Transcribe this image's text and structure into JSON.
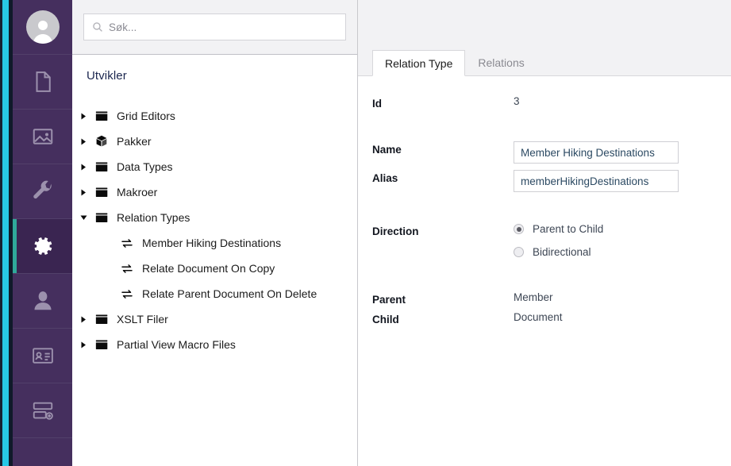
{
  "rail": {
    "avatar": {
      "icon": "user-avatar-icon"
    },
    "items": [
      {
        "icon": "document-icon",
        "name": "content",
        "active": false
      },
      {
        "icon": "media-image-icon",
        "name": "media",
        "active": false
      },
      {
        "icon": "wrench-icon",
        "name": "settings",
        "active": false
      },
      {
        "icon": "gear-icon",
        "name": "developer",
        "active": true
      },
      {
        "icon": "user-icon",
        "name": "users",
        "active": false
      },
      {
        "icon": "id-card-icon",
        "name": "members",
        "active": false
      },
      {
        "icon": "forms-icon",
        "name": "forms",
        "active": false
      }
    ]
  },
  "search": {
    "placeholder": "Søk...",
    "value": "",
    "icon": "search-icon"
  },
  "tree": {
    "title": "Utvikler",
    "nodes": [
      {
        "label": "Grid Editors",
        "icon": "folder-icon",
        "level": 0,
        "expanded": false,
        "has_caret": true
      },
      {
        "label": "Pakker",
        "icon": "package-icon",
        "level": 0,
        "expanded": false,
        "has_caret": true
      },
      {
        "label": "Data Types",
        "icon": "folder-icon",
        "level": 0,
        "expanded": false,
        "has_caret": true
      },
      {
        "label": "Makroer",
        "icon": "folder-icon",
        "level": 0,
        "expanded": false,
        "has_caret": true
      },
      {
        "label": "Relation Types",
        "icon": "folder-icon",
        "level": 0,
        "expanded": true,
        "has_caret": true
      },
      {
        "label": "Member Hiking Destinations",
        "icon": "exchange-arrows-icon",
        "level": 1,
        "expanded": false,
        "has_caret": false
      },
      {
        "label": "Relate Document On Copy",
        "icon": "exchange-arrows-icon",
        "level": 1,
        "expanded": false,
        "has_caret": false
      },
      {
        "label": "Relate Parent Document On Delete",
        "icon": "exchange-arrows-icon",
        "level": 1,
        "expanded": false,
        "has_caret": false
      },
      {
        "label": "XSLT Filer",
        "icon": "folder-icon",
        "level": 0,
        "expanded": false,
        "has_caret": true
      },
      {
        "label": "Partial View Macro Files",
        "icon": "folder-icon",
        "level": 0,
        "expanded": false,
        "has_caret": true
      }
    ]
  },
  "detail": {
    "tabs": [
      {
        "label": "Relation Type",
        "active": true
      },
      {
        "label": "Relations",
        "active": false
      }
    ],
    "fields": {
      "id_label": "Id",
      "id_value": "3",
      "name_label": "Name",
      "name_value": "Member Hiking Destinations",
      "alias_label": "Alias",
      "alias_value": "memberHikingDestinations",
      "direction_label": "Direction",
      "direction_options": [
        {
          "label": "Parent to Child",
          "checked": true
        },
        {
          "label": "Bidirectional",
          "checked": false
        }
      ],
      "parent_label": "Parent",
      "parent_value": "Member",
      "child_label": "Child",
      "child_value": "Document"
    }
  },
  "colors": {
    "rail_bg": "#452f5e",
    "rail_active_bg": "#3a2551",
    "accent_teal": "#2fa99a",
    "edge_cyan": "#28c8e6",
    "header_bg": "#f2f2f4",
    "input_text": "#2c4a63"
  }
}
